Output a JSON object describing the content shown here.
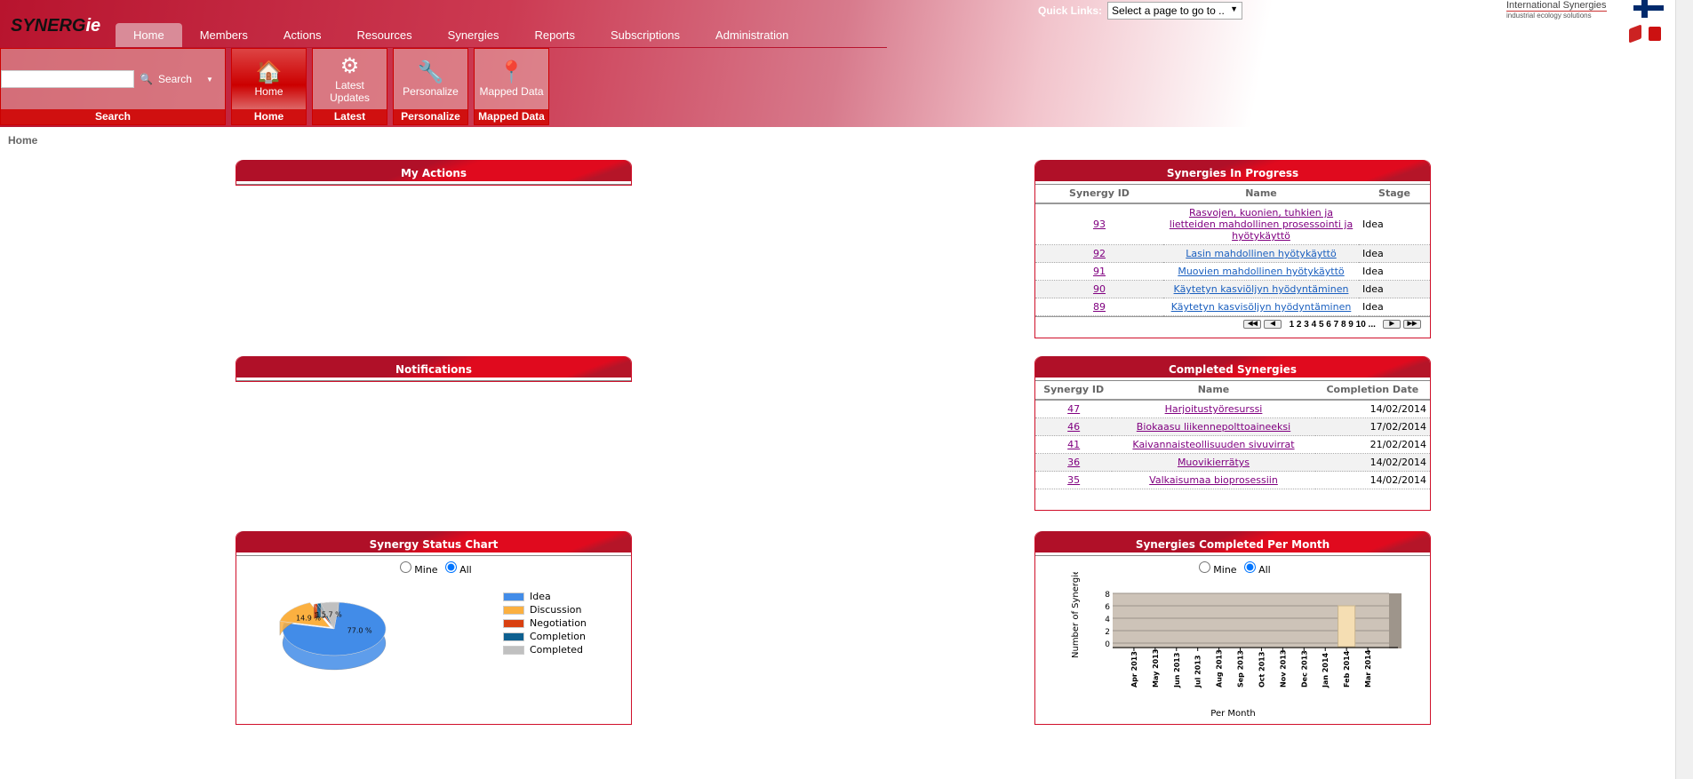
{
  "header": {
    "logo": "SYNERGie",
    "logo_suffix": "ie",
    "quick_links_label": "Quick Links:",
    "quick_links_value": "Select a page to go to ..",
    "partner": "International Synergies",
    "partner_tagline": "industrial ecology solutions"
  },
  "nav": {
    "tabs": [
      "Home",
      "Members",
      "Actions",
      "Resources",
      "Synergies",
      "Reports",
      "Subscriptions",
      "Administration"
    ],
    "active": "Home"
  },
  "ribbon": {
    "search_placeholder": "",
    "search_label": "Search",
    "groups": [
      {
        "label": "Home",
        "caption": "Home"
      },
      {
        "label": "Latest Updates",
        "caption": "Latest Updates"
      },
      {
        "label": "Personalize",
        "caption": "Personalize"
      },
      {
        "label": "Mapped Data",
        "caption": "Mapped Data"
      }
    ],
    "search_caption": "Search"
  },
  "breadcrumb": "Home",
  "my_actions": {
    "title": "My Actions"
  },
  "notifications": {
    "title": "Notifications"
  },
  "in_progress": {
    "title": "Synergies In Progress",
    "columns": [
      "Synergy ID",
      "Name",
      "Stage"
    ],
    "rows": [
      [
        "93",
        "Rasvojen, kuonien, tuhkien ja lietteiden mahdollinen prosessointi ja hyötykäyttö",
        "Idea"
      ],
      [
        "92",
        "Lasin mahdollinen hyötykäyttö",
        "Idea"
      ],
      [
        "91",
        "Muovien mahdollinen hyötykäyttö",
        "Idea"
      ],
      [
        "90",
        "Käytetyn kasviöljyn hyödyntäminen",
        "Idea"
      ],
      [
        "89",
        "Käytetyn kasvisöljyn hyödyntäminen",
        "Idea"
      ]
    ],
    "pages": "1 2 3 4 5 6 7 8 9 10 ..."
  },
  "completed": {
    "title": "Completed Synergies",
    "columns": [
      "Synergy ID",
      "Name",
      "Completion Date"
    ],
    "rows": [
      [
        "47",
        "Harjoitustyöresurssi",
        "14/02/2014"
      ],
      [
        "46",
        "Biokaasu liikennepolttoaineeksi",
        "17/02/2014"
      ],
      [
        "41",
        "Kaivannaisteollisuuden sivuvirrat",
        "21/02/2014"
      ],
      [
        "36",
        "Muovikierrätys",
        "14/02/2014"
      ],
      [
        "35",
        "Valkaisumaa bioprosessiin",
        "14/02/2014"
      ]
    ]
  },
  "status_chart": {
    "title": "Synergy Status Chart",
    "radio_mine": "Mine",
    "radio_all": "All",
    "selected": "All"
  },
  "per_month": {
    "title": "Synergies Completed Per Month",
    "radio_mine": "Mine",
    "radio_all": "All",
    "selected": "All"
  },
  "chart_data": [
    {
      "type": "pie",
      "categories": [
        "Idea",
        "Discussion",
        "Negotiation",
        "Completion",
        "Completed"
      ],
      "values": [
        77.0,
        14.9,
        1.1,
        1.1,
        5.7
      ],
      "labels": [
        "77.0 %",
        "14.9 %",
        "1.1 %",
        "1.1 %",
        "5.7 %"
      ],
      "colors": [
        "#428ce8",
        "#fbb040",
        "#d94010",
        "#0e6090",
        "#c0c0c0"
      ],
      "legend": "right"
    },
    {
      "type": "bar",
      "categories": [
        "Apr 2013",
        "May 2013",
        "Jun 2013",
        "Jul 2013",
        "Aug 2013",
        "Sep 2013",
        "Oct 2013",
        "Nov 2013",
        "Dec 2013",
        "Jan 2014",
        "Feb 2014",
        "Mar 2014"
      ],
      "values": [
        0,
        0,
        0,
        0,
        0,
        0,
        0,
        0,
        0,
        0,
        6,
        0
      ],
      "ylabel": "Number of Synergies",
      "xlabel": "Per Month",
      "ylim": [
        0,
        8
      ],
      "yticks": [
        "0",
        "2",
        "4",
        "6",
        "8"
      ],
      "grid": true
    }
  ]
}
